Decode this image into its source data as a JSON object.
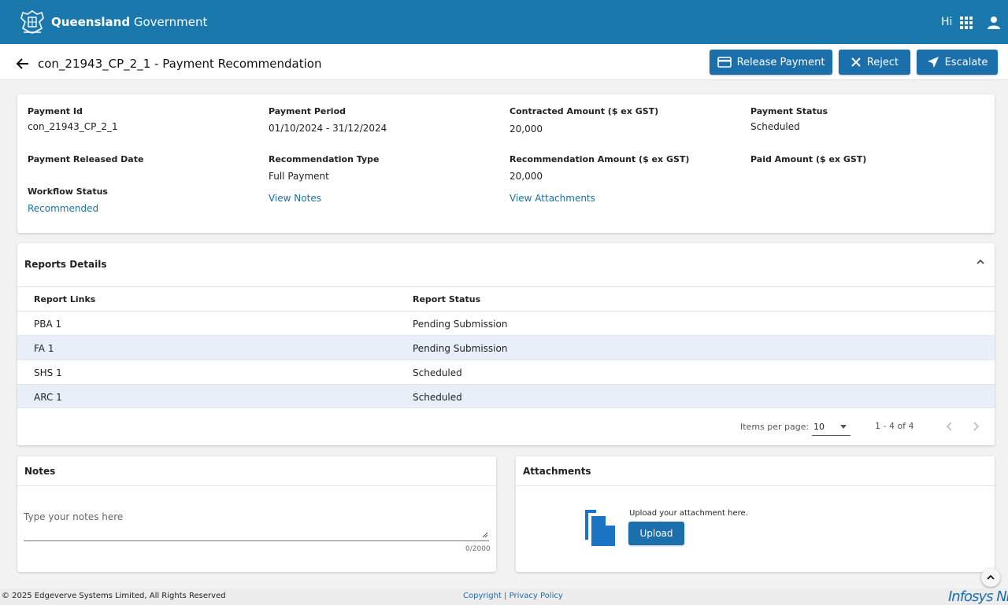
{
  "header": {
    "brand_bold": "Queensland",
    "brand_light": " Government",
    "greeting": "Hi",
    "icons": {
      "logo": "coat-of-arms-logo",
      "apps": "apps-grid-icon",
      "user": "user-icon"
    },
    "color": "#1b78ad"
  },
  "titlebar": {
    "title": "con_21943_CP_2_1 - Payment Recommendation",
    "actions": {
      "release": "Release Payment",
      "reject": "Reject",
      "escalate": "Escalate"
    },
    "button_color": "#1b6faa"
  },
  "details": {
    "payment_id": {
      "label": "Payment Id",
      "value": "con_21943_CP_2_1"
    },
    "payment_period": {
      "label": "Payment Period",
      "value": "01/10/2024 - 31/12/2024"
    },
    "contracted_amount": {
      "label": "Contracted Amount ($ ex GST)",
      "value": "20,000"
    },
    "payment_status": {
      "label": "Payment Status",
      "value": "Scheduled"
    },
    "released_date": {
      "label": "Payment Released Date",
      "value": ""
    },
    "recommendation_type": {
      "label": "Recommendation Type",
      "value": "Full Payment"
    },
    "recommendation_amount": {
      "label": "Recommendation Amount ($ ex GST)",
      "value": "20,000"
    },
    "paid_amount": {
      "label": "Paid Amount ($ ex GST)",
      "value": ""
    },
    "workflow_status": {
      "label": "Workflow Status",
      "value": "Recommended"
    },
    "view_notes": "View Notes",
    "view_attachments": "View Attachments"
  },
  "reports": {
    "title": "Reports Details",
    "columns": [
      "Report Links",
      "Report Status"
    ],
    "rows": [
      {
        "link": "PBA 1",
        "status": "Pending Submission"
      },
      {
        "link": "FA 1",
        "status": "Pending Submission"
      },
      {
        "link": "SHS 1",
        "status": "Scheduled"
      },
      {
        "link": "ARC 1",
        "status": "Scheduled"
      }
    ],
    "paginator": {
      "items_per_page_label": "Items per page:",
      "items_per_page": "10",
      "range": "1 - 4 of 4"
    }
  },
  "notes": {
    "title": "Notes",
    "placeholder": "Type your notes here",
    "counter": "0/2000"
  },
  "attachments": {
    "title": "Attachments",
    "prompt": "Upload your attachment here.",
    "upload": "Upload"
  },
  "footer": {
    "copyright": "© 2025 Edgeverve Systems Limited, All Rights Reserved",
    "copyright_link": "Copyright",
    "separator": " | ",
    "privacy_link": "Privacy Policy",
    "logo_text": "Infosys NIA"
  }
}
